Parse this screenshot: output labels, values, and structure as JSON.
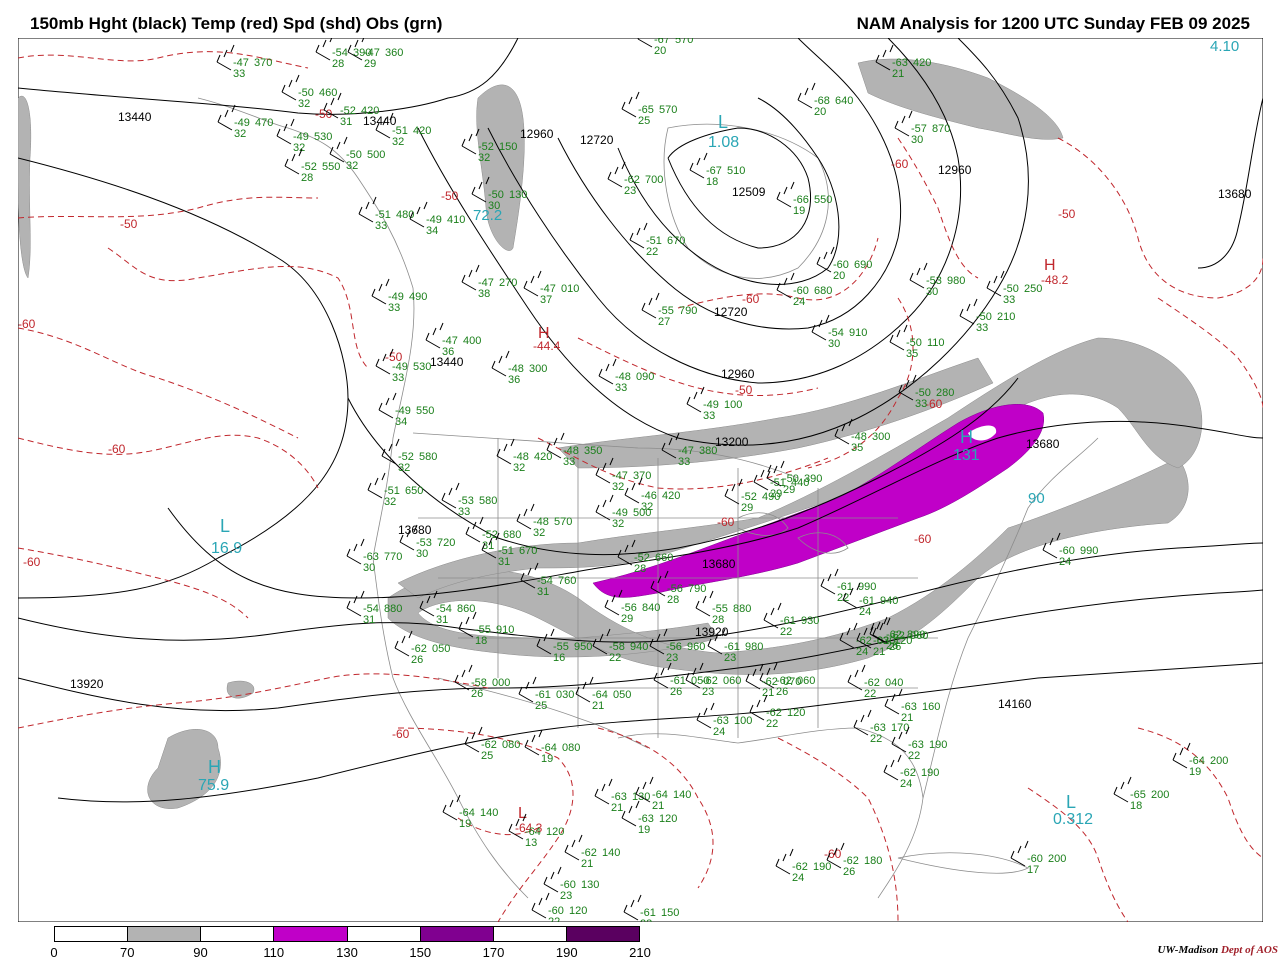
{
  "header": {
    "left": "150mb Hght (black) Temp (red) Spd (shd) Obs (grn)",
    "right": "NAM Analysis for 1200 UTC Sunday  FEB 09 2025"
  },
  "legend": {
    "ticks": [
      "0",
      "70",
      "90",
      "110",
      "130",
      "150",
      "170",
      "190",
      "210"
    ],
    "colors": [
      "#ffffff",
      "#b3b3b3",
      "#ffffff",
      "#c000c8",
      "#ffffff",
      "#800090",
      "#ffffff",
      "#5a0060"
    ]
  },
  "credit": {
    "left": "UW-Madison",
    "right": "Dept of AOS"
  },
  "colors": {
    "height": "#000000",
    "temp": "#c0272d",
    "obs": "#1a7f1a",
    "highlow": "#2aa6b5",
    "map": "#8c8c8c"
  },
  "contour_labels": [
    "13440",
    "13440",
    "12960",
    "12720",
    "12509",
    "12960",
    "13680",
    "12720",
    "13440",
    "12960",
    "13200",
    "13680",
    "13680",
    "13680",
    "13920",
    "13920",
    "14160"
  ],
  "temp_labels": [
    "-50",
    "-50",
    "-50",
    "-50",
    "-50",
    "-60",
    "-60",
    "-60",
    "-60",
    "-60",
    "-60",
    "-60",
    "-60",
    "-50",
    "-60",
    "-60"
  ],
  "temp_extrema": [
    {
      "letter": "H",
      "value": "-44.4"
    },
    {
      "letter": "H",
      "value": "-48.2"
    },
    {
      "letter": "L",
      "value": "-64.3"
    }
  ],
  "speed_extrema": [
    {
      "letter": "L",
      "value": "16.9"
    },
    {
      "letter": "H",
      "value": "75.9"
    },
    {
      "letter": "L",
      "value": "1.08"
    },
    {
      "letter": "L",
      "value": "0.312"
    },
    {
      "letter": "H",
      "value": "131"
    },
    {
      "letter": "",
      "value": "4.10"
    },
    {
      "letter": "",
      "value": "90"
    },
    {
      "letter": "",
      "value": "72.2"
    }
  ],
  "observations": [
    {
      "t": "-47",
      "d": "33",
      "h": "370"
    },
    {
      "t": "-54",
      "d": "28",
      "h": "390"
    },
    {
      "t": "-47",
      "d": "29",
      "h": "360"
    },
    {
      "t": "-50",
      "d": "32",
      "h": "460"
    },
    {
      "t": "-52",
      "d": "31",
      "h": "420"
    },
    {
      "t": "-49",
      "d": "32",
      "h": "470"
    },
    {
      "t": "-49",
      "d": "32",
      "h": "530"
    },
    {
      "t": "-51",
      "d": "32",
      "h": "420"
    },
    {
      "t": "-50",
      "d": "32",
      "h": "500"
    },
    {
      "t": "-52",
      "d": "28",
      "h": "550"
    },
    {
      "t": "-52",
      "d": "32",
      "h": "150"
    },
    {
      "t": "-50",
      "d": "30",
      "h": "130"
    },
    {
      "t": "-51",
      "d": "33",
      "h": "480"
    },
    {
      "t": "-49",
      "d": "34",
      "h": "410"
    },
    {
      "t": "-49",
      "d": "33",
      "h": "490"
    },
    {
      "t": "-47",
      "d": "38",
      "h": "270"
    },
    {
      "t": "-47",
      "d": "37",
      "h": "010"
    },
    {
      "t": "-47",
      "d": "36",
      "h": "400"
    },
    {
      "t": "-49",
      "d": "33",
      "h": "530"
    },
    {
      "t": "-48",
      "d": "36",
      "h": "300"
    },
    {
      "t": "-49",
      "d": "34",
      "h": "550"
    },
    {
      "t": "-52",
      "d": "32",
      "h": "580"
    },
    {
      "t": "-48",
      "d": "32",
      "h": "420"
    },
    {
      "t": "-48",
      "d": "33",
      "h": "350"
    },
    {
      "t": "-51",
      "d": "32",
      "h": "650"
    },
    {
      "t": "-53",
      "d": "33",
      "h": "580"
    },
    {
      "t": "-67",
      "d": "20",
      "h": "570"
    },
    {
      "t": "-65",
      "d": "25",
      "h": "570"
    },
    {
      "t": "-67",
      "d": "18",
      "h": "510"
    },
    {
      "t": "-62",
      "d": "23",
      "h": "700"
    },
    {
      "t": "-51",
      "d": "22",
      "h": "670"
    },
    {
      "t": "-66",
      "d": "19",
      "h": "550"
    },
    {
      "t": "-60",
      "d": "24",
      "h": "680"
    },
    {
      "t": "-55",
      "d": "27",
      "h": "790"
    },
    {
      "t": "-48",
      "d": "33",
      "h": "090"
    },
    {
      "t": "-49",
      "d": "33",
      "h": "100"
    },
    {
      "t": "-54",
      "d": "30",
      "h": "910"
    },
    {
      "t": "-60",
      "d": "20",
      "h": "690"
    },
    {
      "t": "-53",
      "d": "30",
      "h": "980"
    },
    {
      "t": "-63",
      "d": "21",
      "h": "420"
    },
    {
      "t": "-68",
      "d": "20",
      "h": "640"
    },
    {
      "t": "-57",
      "d": "30",
      "h": "870"
    },
    {
      "t": "-50",
      "d": "33",
      "h": "210"
    },
    {
      "t": "-50",
      "d": "33",
      "h": "250"
    },
    {
      "t": "-50",
      "d": "35",
      "h": "110"
    },
    {
      "t": "-50",
      "d": "33",
      "h": "280"
    },
    {
      "t": "-48",
      "d": "35",
      "h": "300"
    },
    {
      "t": "-47",
      "d": "33",
      "h": "380"
    },
    {
      "t": "-47",
      "d": "32",
      "h": "370"
    },
    {
      "t": "-46",
      "d": "32",
      "h": "420"
    },
    {
      "t": "-49",
      "d": "32",
      "h": "500"
    },
    {
      "t": "-52",
      "d": "29",
      "h": "490"
    },
    {
      "t": "-51",
      "d": "29",
      "h": "440"
    },
    {
      "t": "-50",
      "d": "29",
      "h": "390"
    },
    {
      "t": "-53",
      "d": "30",
      "h": "720"
    },
    {
      "t": "-52",
      "d": "31",
      "h": "680"
    },
    {
      "t": "-51",
      "d": "31",
      "h": "670"
    },
    {
      "t": "-63",
      "d": "30",
      "h": "770"
    },
    {
      "t": "-48",
      "d": "32",
      "h": "570"
    },
    {
      "t": "-52",
      "d": "28",
      "h": "660"
    },
    {
      "t": "-54",
      "d": "31",
      "h": "760"
    },
    {
      "t": "-54",
      "d": "31",
      "h": "880"
    },
    {
      "t": "-54",
      "d": "31",
      "h": "860"
    },
    {
      "t": "-56",
      "d": "29",
      "h": "840"
    },
    {
      "t": "-56",
      "d": "28",
      "h": "790"
    },
    {
      "t": "-55",
      "d": "28",
      "h": "880"
    },
    {
      "t": "-55",
      "d": "18",
      "h": "910"
    },
    {
      "t": "-55",
      "d": "16",
      "h": "950"
    },
    {
      "t": "-62",
      "d": "26",
      "h": "050"
    },
    {
      "t": "-58",
      "d": "26",
      "h": "000"
    },
    {
      "t": "-58",
      "d": "22",
      "h": "940"
    },
    {
      "t": "-56",
      "d": "23",
      "h": "960"
    },
    {
      "t": "-61",
      "d": "23",
      "h": "980"
    },
    {
      "t": "-61",
      "d": "22",
      "h": "930"
    },
    {
      "t": "-62",
      "d": "24",
      "h": "020"
    },
    {
      "t": "-61",
      "d": "26",
      "h": "050"
    },
    {
      "t": "-62",
      "d": "26",
      "h": "060"
    },
    {
      "t": "-63",
      "d": "21",
      "h": "120"
    },
    {
      "t": "-62",
      "d": "22",
      "h": "040"
    },
    {
      "t": "-62",
      "d": "23",
      "h": "060"
    },
    {
      "t": "-62",
      "d": "21",
      "h": "070"
    },
    {
      "t": "-61",
      "d": "25",
      "h": "030"
    },
    {
      "t": "-64",
      "d": "21",
      "h": "050"
    },
    {
      "t": "-63",
      "d": "24",
      "h": "100"
    },
    {
      "t": "-62",
      "d": "22",
      "h": "120"
    },
    {
      "t": "-62",
      "d": "25",
      "h": "080"
    },
    {
      "t": "-64",
      "d": "19",
      "h": "080"
    },
    {
      "t": "-63",
      "d": "21",
      "h": "160"
    },
    {
      "t": "-63",
      "d": "22",
      "h": "170"
    },
    {
      "t": "-63",
      "d": "22",
      "h": "190"
    },
    {
      "t": "-62",
      "d": "24",
      "h": "190"
    },
    {
      "t": "-63",
      "d": "21",
      "h": "130"
    },
    {
      "t": "-63",
      "d": "19",
      "h": "120"
    },
    {
      "t": "-64",
      "d": "21",
      "h": "140"
    },
    {
      "t": "-64",
      "d": "19",
      "h": "140"
    },
    {
      "t": "-64",
      "d": "13",
      "h": "120"
    },
    {
      "t": "-62",
      "d": "21",
      "h": "140"
    },
    {
      "t": "-60",
      "d": "23",
      "h": "130"
    },
    {
      "t": "-60",
      "d": "22",
      "h": "120"
    },
    {
      "t": "-61",
      "d": "23",
      "h": "150"
    },
    {
      "t": "-60",
      "d": "24",
      "h": "990"
    },
    {
      "t": "-61",
      "d": "22",
      "h": "990"
    },
    {
      "t": "-61",
      "d": "24",
      "h": "940"
    },
    {
      "t": "-62",
      "d": "26",
      "h": "890"
    },
    {
      "t": "-62",
      "d": "26",
      "h": "060"
    },
    {
      "t": "-64",
      "d": "19",
      "h": "200"
    },
    {
      "t": "-65",
      "d": "18",
      "h": "200"
    },
    {
      "t": "-60",
      "d": "17",
      "h": "200"
    },
    {
      "t": "-62",
      "d": "24",
      "h": "190"
    },
    {
      "t": "-62",
      "d": "26",
      "h": "180"
    }
  ]
}
